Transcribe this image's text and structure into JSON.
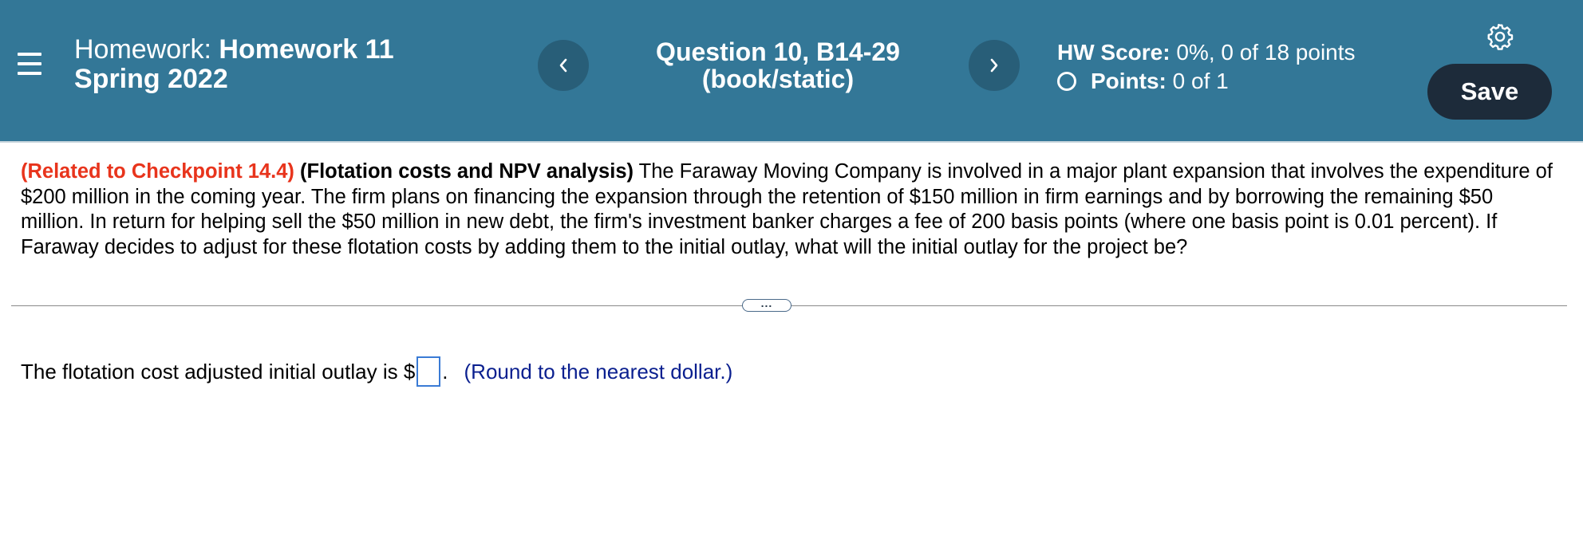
{
  "header": {
    "homework_prefix": "Homework:",
    "homework_name": "Homework 11",
    "term": "Spring 2022",
    "question_title": "Question 10, B14-29",
    "question_subtitle": "(book/static)",
    "hw_score_label": "HW Score:",
    "hw_score_value": "0%, 0 of 18 points",
    "points_label": "Points:",
    "points_value": "0 of 1",
    "save_label": "Save",
    "prev_icon": "chevron-left-icon",
    "next_icon": "chevron-right-icon",
    "settings_icon": "gear-icon",
    "menu_icon": "hamburger-menu-icon"
  },
  "question": {
    "reference": "(Related to Checkpoint 14.4)",
    "topic": "(Flotation costs and NPV analysis)",
    "body": "The Faraway Moving Company is involved in a major plant expansion that involves the expenditure of $200 million in the coming year.  The firm plans on financing the expansion through the retention of $150 million in firm earnings and by borrowing the remaining $50 million.  In return for helping sell the $50 million in new debt, the firm's investment banker charges a fee of 200 basis points (where one basis point is 0.01 percent).  If Faraway decides to adjust for these flotation costs by adding them to the initial outlay, what will the initial outlay for the project be?"
  },
  "expand_label": "...",
  "answer": {
    "prompt": "The flotation cost adjusted initial outlay is $",
    "value": "",
    "after_input": ".",
    "note": "(Round to the nearest dollar.)"
  },
  "colors": {
    "header_bg": "#337797",
    "nav_button_bg": "#285e78",
    "save_button_bg": "#1d2b3a",
    "reference_red": "#e8341c",
    "note_blue": "#0a1f8f",
    "input_border": "#3a7bd5"
  }
}
